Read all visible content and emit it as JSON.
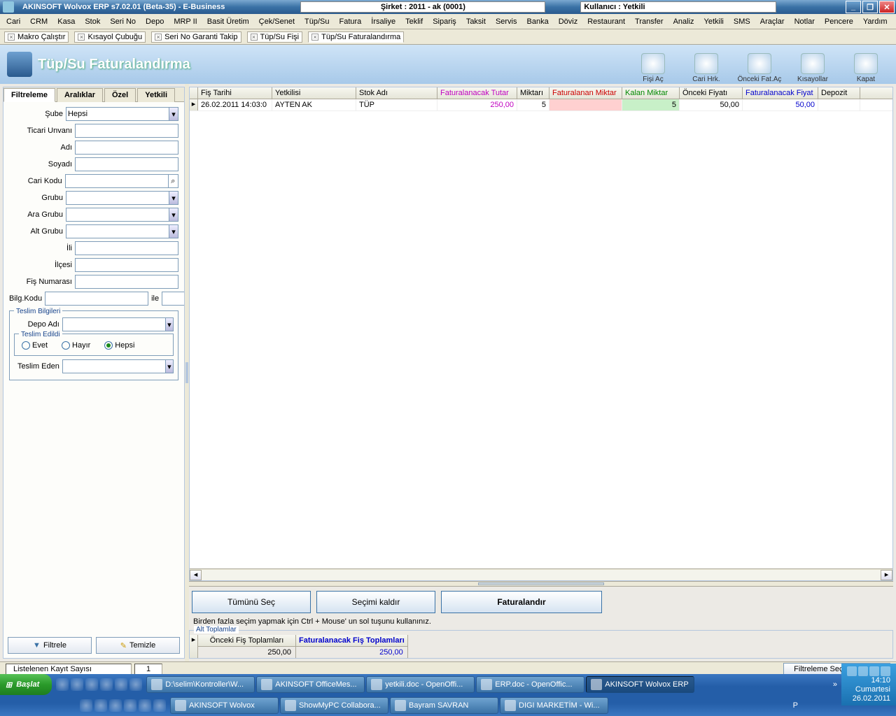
{
  "titlebar": {
    "app_title": "AKINSOFT Wolvox ERP s7.02.01 (Beta-35) - E-Business",
    "sirket": "Şirket : 2011 - ak (0001)",
    "kullanici": "Kullanıcı : Yetkili"
  },
  "menubar": [
    "Cari",
    "CRM",
    "Kasa",
    "Stok",
    "Seri No",
    "Depo",
    "MRP II",
    "Basit Üretim",
    "Çek/Senet",
    "Tüp/Su",
    "Fatura",
    "İrsaliye",
    "Teklif",
    "Sipariş",
    "Taksit",
    "Servis",
    "Banka",
    "Döviz",
    "Restaurant",
    "Transfer",
    "Analiz",
    "Yetkili",
    "SMS",
    "Araçlar",
    "Notlar",
    "Pencere",
    "Yardım"
  ],
  "intabs": [
    "Makro Çalıştır",
    "Kısayol Çubuğu",
    "Seri No Garanti Takip",
    "Tüp/Su Fişi",
    "Tüp/Su Faturalandırma"
  ],
  "intabs_active": 4,
  "module": {
    "title": "Tüp/Su Faturalandırma",
    "buttons": [
      "Fişi Aç",
      "Cari Hrk.",
      "Önceki Fat.Aç",
      "Kısayollar",
      "Kapat"
    ]
  },
  "leftpanel": {
    "tabs": [
      "Filtreleme",
      "Aralıklar",
      "Özel",
      "Yetkili"
    ],
    "active": 0,
    "fields": {
      "sube_label": "Şube",
      "sube_value": "Hepsi",
      "ticari_unvani": "Ticari Unvanı",
      "adi": "Adı",
      "soyadi": "Soyadı",
      "cari_kodu": "Cari Kodu",
      "grubu": "Grubu",
      "ara_grubu": "Ara Grubu",
      "alt_grubu": "Alt Grubu",
      "ili": "İli",
      "ilcesi": "İlçesi",
      "fis_numarasi": "Fiş Numarası",
      "bilg_kodu": "Bilg.Kodu",
      "ile": "ile",
      "teslim_bilgileri": "Teslim Bilgileri",
      "depo_adi": "Depo Adı",
      "teslim_edildi": "Teslim Edildi",
      "evet": "Evet",
      "hayir": "Hayır",
      "hepsi": "Hepsi",
      "teslim_eden": "Teslim Eden"
    },
    "buttons": {
      "filtrele": "Filtrele",
      "temizle": "Temizle"
    }
  },
  "grid": {
    "headers": {
      "fis_tarihi": "Fiş Tarihi",
      "yetkilisi": "Yetkilisi",
      "stok_adi": "Stok Adı",
      "fat_tutar": "Faturalanacak Tutar",
      "miktari": "Miktarı",
      "fat_miktar": "Faturalanan Miktar",
      "kalan": "Kalan Miktar",
      "onceki": "Önceki Fiyatı",
      "fat_fiyat": "Faturalanacak Fiyat",
      "depozit": "Depozit"
    },
    "rows": [
      {
        "fis_tarihi": "26.02.2011 14:03:0",
        "yetkilisi": "AYTEN AK",
        "stok_adi": "TÜP",
        "fat_tutar": "250,00",
        "miktari": "5",
        "fat_miktar": "",
        "kalan": "5",
        "onceki": "50,00",
        "fat_fiyat": "50,00",
        "depozit": ""
      }
    ]
  },
  "actions": {
    "tumunu_sec": "Tümünü Seç",
    "secimi_kaldir": "Seçimi kaldır",
    "faturalandir": "Faturalandır",
    "hint": "Birden fazla seçim yapmak için Ctrl + Mouse' un sol tuşunu kullanınız."
  },
  "subtotals": {
    "legend": "Alt Toplamlar",
    "col1_h": "Önceki Fiş Toplamları",
    "col1_v": "250,00",
    "col2_h": "Faturalanacak Fiş Toplamları",
    "col2_v": "250,00"
  },
  "status": {
    "listelenen": "Listelenen Kayıt Sayısı",
    "count": "1",
    "filtsec": "Filtreleme Seçenekleri"
  },
  "taskbar": {
    "start": "Başlat",
    "tasks_row1": [
      "D:\\selim\\Kontroller\\W...",
      "AKINSOFT OfficeMes...",
      "yetkili.doc - OpenOffi...",
      "ERP.doc - OpenOffic...",
      "AKINSOFT Wolvox ERP"
    ],
    "tasks_row2": [
      "AKINSOFT Wolvox",
      "ShowMyPC Collabora...",
      "Bayram SAVRAN",
      "DIGI MARKETİM - Wi..."
    ],
    "active_task": 4,
    "p_indicator": "P",
    "time": "14:10",
    "day": "Cumartesi",
    "date": "26.02.2011"
  }
}
